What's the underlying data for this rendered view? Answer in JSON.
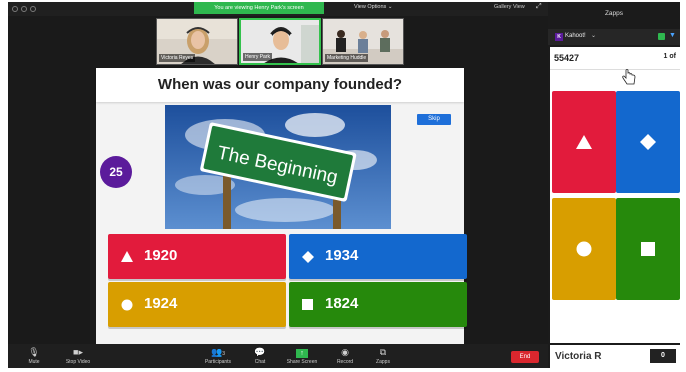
{
  "colors": {
    "red": "#e21b3c",
    "blue": "#1368ce",
    "yellow": "#d89e00",
    "green": "#26890c",
    "purple": "#5b1b9b",
    "zoom_green": "#2fb84f",
    "end_red": "#d9272e"
  },
  "zoom": {
    "viewing_banner": "You are viewing Henry Park's screen",
    "view_options": "View Options",
    "gallery_view": "Gallery View",
    "participants": [
      {
        "name": "Victoria Reyes"
      },
      {
        "name": "Henry Park"
      },
      {
        "name": "Marketing Huddle"
      }
    ],
    "controls": {
      "mute": "Mute",
      "stop_video": "Stop Video",
      "participants": "Participants",
      "participants_count": "3",
      "chat": "Chat",
      "share_screen": "Share Screen",
      "record": "Record",
      "zapps": "Zapps",
      "end": "End"
    }
  },
  "quiz": {
    "question": "When was our company founded?",
    "skip": "Skip",
    "timer": "25",
    "image_sign_text": "The Beginning",
    "answers": [
      {
        "shape": "triangle",
        "label": "1920",
        "color": "red"
      },
      {
        "shape": "diamond",
        "label": "1934",
        "color": "blue"
      },
      {
        "shape": "circle",
        "label": "1924",
        "color": "yellow"
      },
      {
        "shape": "square",
        "label": "1824",
        "color": "green"
      }
    ]
  },
  "zapps_panel": {
    "title": "Zapps",
    "app_name": "Kahoot!",
    "game_pin": "55427",
    "question_count": "1 of",
    "player_name": "Victoria R",
    "score": "0"
  }
}
